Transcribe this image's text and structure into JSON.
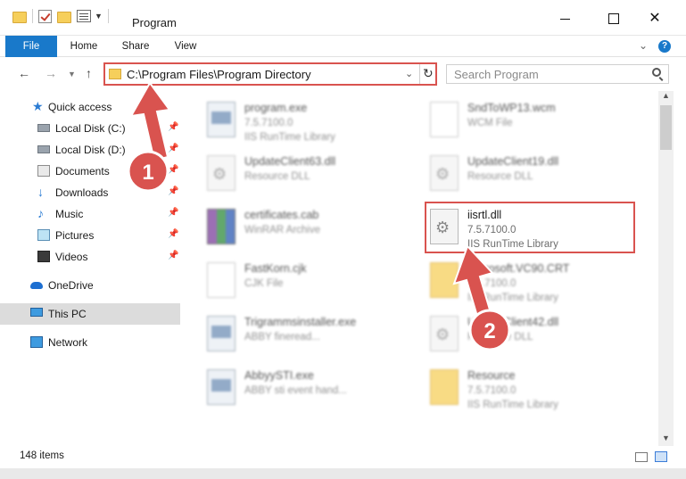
{
  "window": {
    "title": "Program"
  },
  "ribbon": {
    "tabs": [
      "File",
      "Home",
      "Share",
      "View"
    ]
  },
  "navigation": {
    "address_path": "C:\\Program Files\\Program Directory",
    "search_placeholder": "Search Program"
  },
  "sidebar": {
    "items": [
      {
        "label": "Quick access",
        "icon": "star-icon",
        "pinned": false
      },
      {
        "label": "Local Disk (C:)",
        "icon": "drive-icon",
        "pinned": true
      },
      {
        "label": "Local Disk (D:)",
        "icon": "drive-icon",
        "pinned": true
      },
      {
        "label": "Documents",
        "icon": "documents-icon",
        "pinned": true
      },
      {
        "label": "Downloads",
        "icon": "download-icon",
        "pinned": true
      },
      {
        "label": "Music",
        "icon": "music-icon",
        "pinned": true
      },
      {
        "label": "Pictures",
        "icon": "pictures-icon",
        "pinned": true
      },
      {
        "label": "Videos",
        "icon": "videos-icon",
        "pinned": true
      },
      {
        "label": "OneDrive",
        "icon": "cloud-icon",
        "pinned": false
      },
      {
        "label": "This PC",
        "icon": "pc-icon",
        "pinned": false,
        "selected": true
      },
      {
        "label": "Network",
        "icon": "network-icon",
        "pinned": false
      }
    ]
  },
  "files": [
    {
      "name": "program.exe",
      "line2": "7.5.7100.0",
      "line3": "IIS RunTime Library",
      "icon": "exe-icon",
      "blurred": true
    },
    {
      "name": "SndToWP13.wcm",
      "line2": "WCM File",
      "line3": "",
      "icon": "document-icon",
      "blurred": true
    },
    {
      "name": "UpdateClient63.dll",
      "line2": "Resource DLL",
      "line3": "",
      "icon": "dll-icon",
      "blurred": true
    },
    {
      "name": "UpdateClient19.dll",
      "line2": "Resource DLL",
      "line3": "",
      "icon": "dll-icon",
      "blurred": true
    },
    {
      "name": "certificates.cab",
      "line2": "WinRAR Archive",
      "line3": "",
      "icon": "archive-icon",
      "blurred": true
    },
    {
      "name": "iisrtl.dll",
      "line2": "7.5.7100.0",
      "line3": "IIS RunTime Library",
      "icon": "dll-icon",
      "blurred": false
    },
    {
      "name": "FastKorn.cjk",
      "line2": "CJK File",
      "line3": "",
      "icon": "document-icon",
      "blurred": true
    },
    {
      "name": "Microsoft.VC90.CRT",
      "line2": "7.5.7100.0",
      "line3": "IIS RunTime Library",
      "icon": "folder-icon",
      "blurred": true
    },
    {
      "name": "Trigrammsinstaller.exe",
      "line2": "ABBY fineread...",
      "line3": "",
      "icon": "app-icon",
      "blurred": true
    },
    {
      "name": "UpdateClient42.dll",
      "line2": "Resource DLL",
      "line3": "",
      "icon": "dll-icon",
      "blurred": true
    },
    {
      "name": "AbbyySTI.exe",
      "line2": "ABBY sti event hand...",
      "line3": "",
      "icon": "app-icon",
      "blurred": true
    },
    {
      "name": "Resource",
      "line2": "7.5.7100.0",
      "line3": "IIS RunTime Library",
      "icon": "folder-icon",
      "blurred": true
    }
  ],
  "status": {
    "item_count": "148 items"
  },
  "annotations": {
    "step1": "1",
    "step2": "2",
    "color": "#d9534f"
  },
  "colors": {
    "accent": "#1979ca",
    "highlight_border": "#d9534f"
  }
}
